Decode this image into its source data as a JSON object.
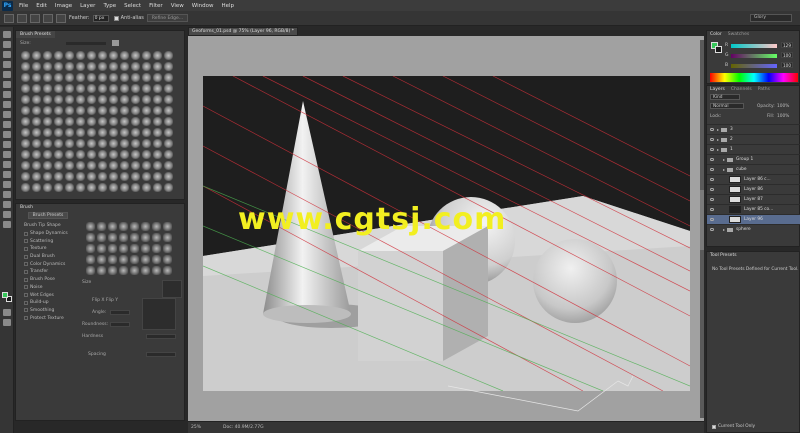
{
  "app": {
    "logo": "Ps"
  },
  "menu": [
    "File",
    "Edit",
    "Image",
    "Layer",
    "Type",
    "Select",
    "Filter",
    "View",
    "Window",
    "Help"
  ],
  "options": {
    "feather_label": "Feather:",
    "feather_value": "0 px",
    "anti_alias": "Anti-alias",
    "refine_edge": "Refine Edge...",
    "workspace": "Glory"
  },
  "brush_presets": {
    "title": "Brush Presets",
    "size_label": "Size:"
  },
  "brush_panel": {
    "tab": "Brush",
    "presets_button": "Brush Presets",
    "items": [
      "Brush Tip Shape",
      "Shape Dynamics",
      "Scattering",
      "Texture",
      "Dual Brush",
      "Color Dynamics",
      "Transfer",
      "Brush Pose",
      "Noise",
      "Wet Edges",
      "Build-up",
      "Smoothing",
      "Protect Texture"
    ],
    "size": "Size",
    "flip": "Flip X  Flip Y",
    "angle": "Angle:",
    "roundness": "Roundness:",
    "hardness": "Hardness",
    "spacing": "Spacing"
  },
  "document": {
    "tab_title": "Geoforms_01.psd @ 75% (Layer 96, RGB/8) *",
    "watermark": "www.cgtsj.com",
    "zoom": "25%",
    "doc_size": "Doc: 40.9M/2.77G"
  },
  "color_panel": {
    "tabs": [
      "Color",
      "Swatches"
    ],
    "channels": [
      {
        "name": "R",
        "value": "129"
      },
      {
        "name": "G",
        "value": "100"
      },
      {
        "name": "B",
        "value": "100"
      }
    ]
  },
  "layers_panel": {
    "tabs": [
      "Layers",
      "Channels",
      "Paths"
    ],
    "kind": "Kind",
    "blend_mode": "Normal",
    "opacity_label": "Opacity:",
    "opacity": "100%",
    "lock_label": "Lock:",
    "fill_label": "Fill:",
    "fill": "100%",
    "layers": [
      {
        "name": "3",
        "type": "group",
        "indent": 0
      },
      {
        "name": "2",
        "type": "group",
        "indent": 0
      },
      {
        "name": "1",
        "type": "group",
        "indent": 0
      },
      {
        "name": "Group 1",
        "type": "group",
        "indent": 1
      },
      {
        "name": "cube",
        "type": "group",
        "indent": 1
      },
      {
        "name": "Layer 86 c...",
        "type": "layer",
        "indent": 2
      },
      {
        "name": "Layer 86",
        "type": "layer",
        "indent": 2
      },
      {
        "name": "Layer 87",
        "type": "layer",
        "indent": 2
      },
      {
        "name": "Layer 85 co...",
        "type": "layer-dark",
        "indent": 2
      },
      {
        "name": "Layer 96",
        "type": "layer",
        "indent": 2,
        "selected": true
      },
      {
        "name": "sphere",
        "type": "group",
        "indent": 1
      }
    ]
  },
  "tool_presets": {
    "title": "Tool Presets",
    "message": "No Tool Presets Defined for Current Tool.",
    "current_only": "Current Tool Only"
  }
}
